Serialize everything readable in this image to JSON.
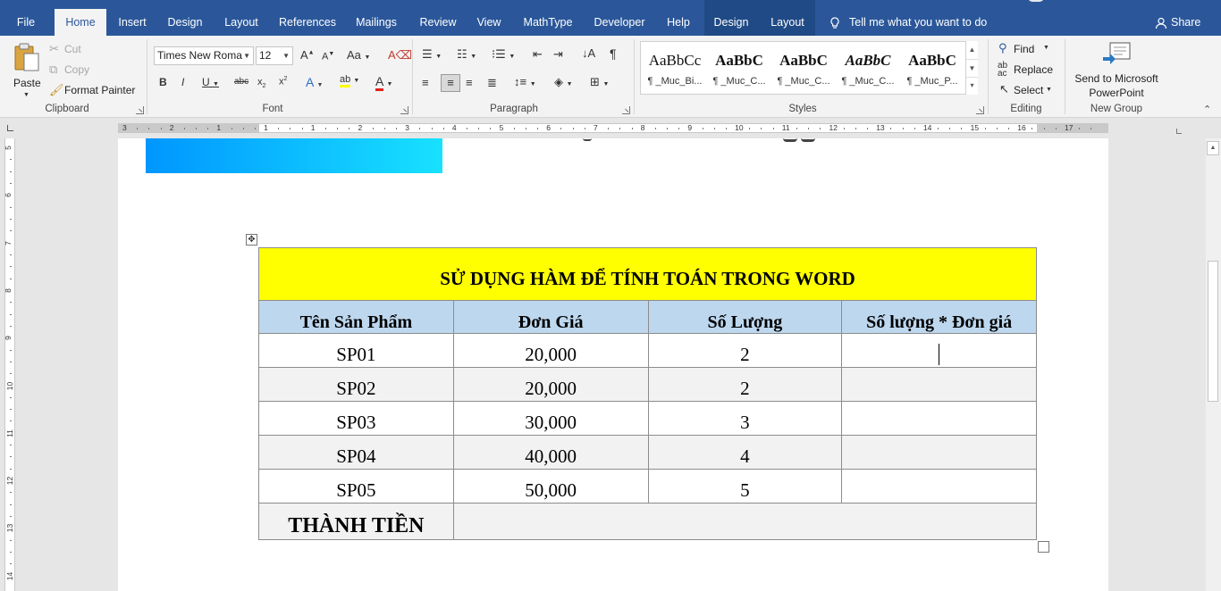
{
  "ribbon": {
    "tabs": [
      {
        "label": "File"
      },
      {
        "label": "Home"
      },
      {
        "label": "Insert"
      },
      {
        "label": "Design"
      },
      {
        "label": "Layout"
      },
      {
        "label": "References"
      },
      {
        "label": "Mailings"
      },
      {
        "label": "Review"
      },
      {
        "label": "View"
      },
      {
        "label": "MathType"
      },
      {
        "label": "Developer"
      },
      {
        "label": "Help"
      },
      {
        "label": "Design"
      },
      {
        "label": "Layout"
      }
    ],
    "tell_me": "Tell me what you want to do",
    "share": "Share",
    "clipboard": {
      "paste": "Paste",
      "cut": "Cut",
      "copy": "Copy",
      "format_painter": "Format Painter",
      "group": "Clipboard"
    },
    "font": {
      "font_name": "Times New Roma",
      "font_size": "12",
      "group": "Font"
    },
    "paragraph": {
      "group": "Paragraph"
    },
    "styles": {
      "group": "Styles",
      "items": [
        {
          "sample": "AaBbCc",
          "name": "¶ _Muc_Bi..."
        },
        {
          "sample": "AaBbC",
          "name": "¶ _Muc_C..."
        },
        {
          "sample": "AaBbC",
          "name": "¶ _Muc_C..."
        },
        {
          "sample": "AaBbC",
          "name": "¶ _Muc_C..."
        },
        {
          "sample": "AaBbC",
          "name": "¶ _Muc_P..."
        }
      ]
    },
    "editing": {
      "find": "Find",
      "replace": "Replace",
      "select": "Select",
      "group": "Editing"
    },
    "new_group": {
      "send_line1": "Send to Microsoft",
      "send_line2": "PowerPoint",
      "group": "New Group"
    }
  },
  "ruler": {
    "h_labels": [
      "3",
      "2",
      "1",
      "1",
      "1",
      "2",
      "3",
      "4",
      "5",
      "6",
      "7",
      "8",
      "9",
      "10",
      "11",
      "12",
      "13",
      "14",
      "15",
      "16",
      "17"
    ],
    "v_labels": [
      "5",
      "6",
      "7",
      "8",
      "9",
      "10",
      "11",
      "12",
      "13",
      "14"
    ]
  },
  "document": {
    "table": {
      "title": "SỬ DỤNG HÀM ĐỂ TÍNH TOÁN TRONG WORD",
      "headers": [
        "Tên Sản Phẩm",
        "Đơn Giá",
        "Số Lượng",
        "Số lượng * Đơn giá"
      ],
      "rows": [
        [
          "SP01",
          "20,000",
          "2",
          ""
        ],
        [
          "SP02",
          "20,000",
          "2",
          ""
        ],
        [
          "SP03",
          "30,000",
          "3",
          ""
        ],
        [
          "SP04",
          "40,000",
          "4",
          ""
        ],
        [
          "SP05",
          "50,000",
          "5",
          ""
        ]
      ],
      "total_label": "THÀNH TIỀN",
      "total_value": ""
    }
  },
  "colors": {
    "ribbon_blue": "#2b579a",
    "title_fill": "#ffff00",
    "header_fill": "#bdd7ee",
    "alt_row_fill": "#f2f2f2",
    "banner_start": "#0096ff",
    "banner_end": "#18e1ff"
  }
}
